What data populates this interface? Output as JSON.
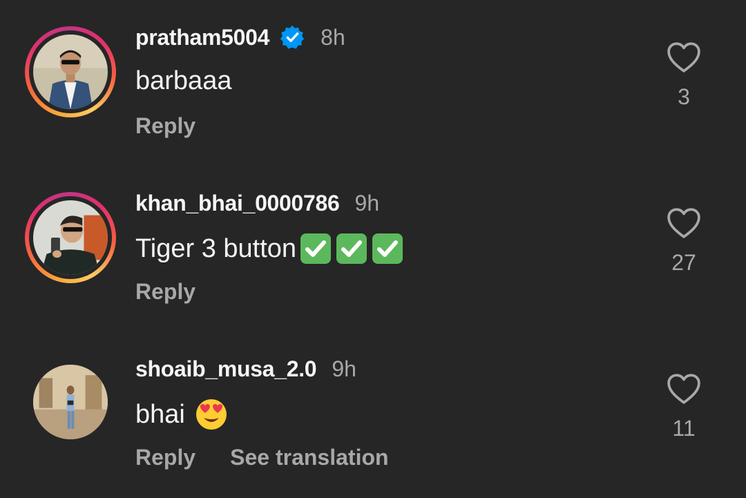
{
  "comments": [
    {
      "username": "pratham5004",
      "verified": true,
      "time": "8h",
      "text": "barbaaa",
      "reply_label": "Reply",
      "likes": "3",
      "has_story_ring": true
    },
    {
      "username": "khan_bhai_0000786",
      "verified": false,
      "time": "9h",
      "text": "Tiger 3 button",
      "emoji": "✅✅✅",
      "reply_label": "Reply",
      "likes": "27",
      "has_story_ring": true
    },
    {
      "username": "shoaib_musa_2.0",
      "verified": false,
      "time": "9h",
      "text": "bhai",
      "emoji": "😍",
      "reply_label": "Reply",
      "translate_label": "See translation",
      "likes": "11",
      "has_story_ring": false
    }
  ],
  "colors": {
    "background": "#262626",
    "primary_text": "#f5f5f5",
    "secondary_text": "#a8a8a8",
    "verified_blue": "#0095f6",
    "check_green": "#5cb85c"
  },
  "icons": {
    "verified": "verified-badge-icon",
    "like": "heart-outline-icon"
  }
}
